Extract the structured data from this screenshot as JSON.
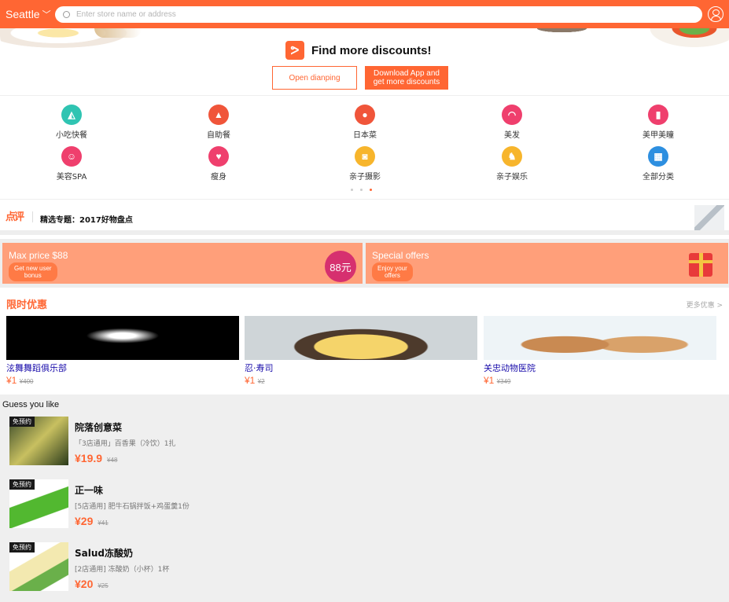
{
  "header": {
    "city": "Seattle",
    "search_placeholder": "Enter store name or address",
    "accent": "#ff6633"
  },
  "banner": {
    "headline": "Find more discounts!",
    "open_button": "Open dianping",
    "download_button_line1": "Download App and",
    "download_button_line2": "get more discounts"
  },
  "categories": [
    {
      "label": "小吃快餐",
      "color": "#2fc4b2",
      "icon": "snack-icon"
    },
    {
      "label": "自助餐",
      "color": "#f0553a",
      "icon": "buffet-icon"
    },
    {
      "label": "日本菜",
      "color": "#f0553a",
      "icon": "japanese-food-icon"
    },
    {
      "label": "美发",
      "color": "#ef3f6d",
      "icon": "hair-icon"
    },
    {
      "label": "美甲美瞳",
      "color": "#ef3f6d",
      "icon": "nail-icon"
    },
    {
      "label": "美容SPA",
      "color": "#ef3f6d",
      "icon": "spa-icon"
    },
    {
      "label": "瘦身",
      "color": "#ef3f6d",
      "icon": "slimming-icon"
    },
    {
      "label": "亲子摄影",
      "color": "#f7b52c",
      "icon": "camera-icon"
    },
    {
      "label": "亲子娱乐",
      "color": "#f7b52c",
      "icon": "rocking-horse-icon"
    },
    {
      "label": "全部分类",
      "color": "#2d8fe0",
      "icon": "all-categories-icon"
    }
  ],
  "topic": {
    "brand": "点评",
    "title": "精选专题：2017好物盘点"
  },
  "promos": [
    {
      "title": "Max price $88",
      "button_line1": "Get new user",
      "button_line2": "bonus",
      "badge": "88元"
    },
    {
      "title": "Special offers",
      "button_line1": "Enjoy your",
      "button_line2": "offers"
    }
  ],
  "limited": {
    "heading": "限时优惠",
    "more": "更多优惠",
    "deals": [
      {
        "name": "泫舞舞蹈俱乐部",
        "price": "¥1",
        "orig": "¥400"
      },
      {
        "name": "忍·寿司",
        "price": "¥1",
        "orig": "¥2"
      },
      {
        "name": "关忠动物医院",
        "price": "¥1",
        "orig": "¥349"
      }
    ]
  },
  "guess": {
    "heading": "Guess you like",
    "items": [
      {
        "tag": "免预约",
        "name": "院落创意菜",
        "desc": "「3店通用」百香果（冷饮）1扎",
        "price": "¥19.9",
        "orig": "¥48"
      },
      {
        "tag": "免预约",
        "name": "正一味",
        "desc": "[5店通用] 肥牛石锅拌饭+鸡蛋羹1份",
        "price": "¥29",
        "orig": "¥41"
      },
      {
        "tag": "免预约",
        "name": "Salud冻酸奶",
        "desc": "[2店通用] 冻酸奶（小杯）1杯",
        "price": "¥20",
        "orig": "¥25"
      }
    ]
  }
}
